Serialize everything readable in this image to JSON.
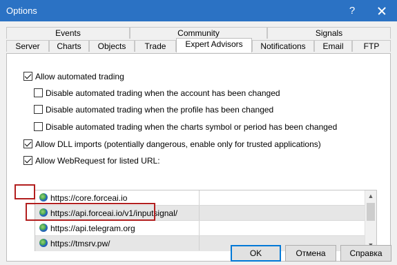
{
  "window": {
    "title": "Options",
    "help_glyph": "?"
  },
  "tabs": {
    "row_top": [
      {
        "label": "Events"
      },
      {
        "label": "Community"
      },
      {
        "label": "Signals"
      }
    ],
    "row_bottom": [
      {
        "label": "Server"
      },
      {
        "label": "Charts"
      },
      {
        "label": "Objects"
      },
      {
        "label": "Trade"
      },
      {
        "label": "Expert Advisors"
      },
      {
        "label": "Notifications"
      },
      {
        "label": "Email"
      },
      {
        "label": "FTP"
      }
    ],
    "active": "Expert Advisors"
  },
  "options": {
    "allow_automated": {
      "label": "Allow automated trading",
      "checked": true
    },
    "disable_account": {
      "label": "Disable automated trading when the account has been changed",
      "checked": false
    },
    "disable_profile": {
      "label": "Disable automated trading when the profile has been changed",
      "checked": false
    },
    "disable_symbol": {
      "label": "Disable automated trading when the charts symbol or period has been changed",
      "checked": false
    },
    "allow_dll": {
      "label": "Allow DLL imports (potentially dangerous, enable only for trusted applications)",
      "checked": true
    },
    "allow_webrequest": {
      "label": "Allow WebRequest for listed URL:",
      "checked": true
    }
  },
  "url_list": {
    "rows": [
      {
        "url": "https://core.forceai.io"
      },
      {
        "url": "https://api.forceai.io/v1/inputsignal/"
      },
      {
        "url": "https://api.telegram.org"
      },
      {
        "url": "https://tmsrv.pw/"
      }
    ],
    "scroll_up_glyph": "▲",
    "scroll_down_glyph": "▼"
  },
  "buttons": {
    "ok": "OK",
    "cancel": "Отмена",
    "help": "Справка"
  },
  "colors": {
    "titlebar": "#2b72c4",
    "highlight_annotation": "#b21e1e",
    "default_button_border": "#0078d7"
  },
  "icons": {
    "close": "close-icon",
    "help": "help-icon",
    "url": "globe-icon",
    "checkbox": "checkmark-icon"
  }
}
